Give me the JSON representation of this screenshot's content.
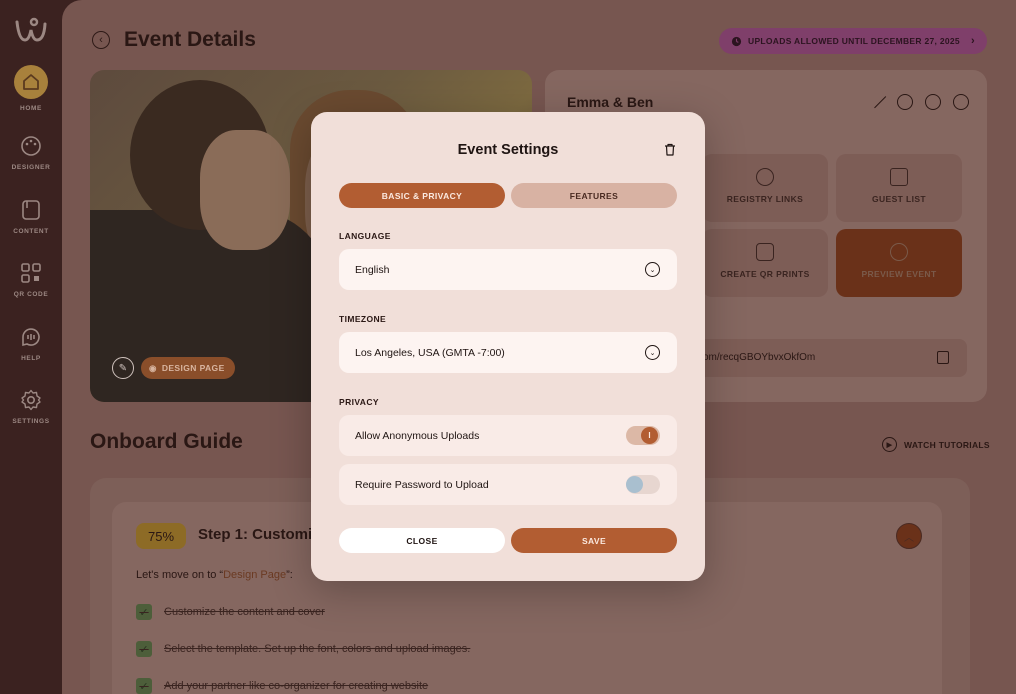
{
  "sidebar": {
    "items": [
      {
        "label": "HOME",
        "icon": "home-icon"
      },
      {
        "label": "DESIGNER",
        "icon": "palette-icon"
      },
      {
        "label": "CONTENT",
        "icon": "content-icon"
      },
      {
        "label": "QR CODE",
        "icon": "qr-code-icon"
      },
      {
        "label": "HELP",
        "icon": "help-icon"
      },
      {
        "label": "SETTINGS",
        "icon": "gear-icon"
      }
    ]
  },
  "header": {
    "title": "Event Details",
    "uploads_pill": "UPLOADS ALLOWED UNTIL DECEMBER 27, 2025"
  },
  "photo": {
    "design_label": "DESIGN PAGE"
  },
  "event_card": {
    "couple": "Emma & Ben",
    "tiles": [
      {
        "label": "REGISTRY LINKS"
      },
      {
        "label": "GUEST LIST"
      },
      {
        "label": "CREATE QR PRINTS"
      },
      {
        "label": "PREVIEW EVENT"
      }
    ],
    "url": "om/recqGBOYbvxOkfOm"
  },
  "onboard": {
    "title": "Onboard Guide",
    "watch_label": "WATCH TUTORIALS",
    "percent": "75%",
    "step_title": "Step 1: Customiz",
    "move_on_prefix": "Let's move on to “",
    "move_on_link": "Design Page",
    "move_on_suffix": "”:",
    "checklist": [
      "Customize the content and cover",
      "Select the template. Set up the font, colors and upload images.",
      "Add your partner like co-organizer for creating website"
    ]
  },
  "modal": {
    "title": "Event Settings",
    "tabs": [
      {
        "label": "BASIC & PRIVACY",
        "active": true
      },
      {
        "label": "FEATURES",
        "active": false
      }
    ],
    "language_label": "LANGUAGE",
    "language_value": "English",
    "timezone_label": "TIMEZONE",
    "timezone_value": "Los Angeles, USA (GMTA -7:00)",
    "privacy_label": "PRIVACY",
    "toggles": [
      {
        "label": "Allow Anonymous Uploads",
        "on": true,
        "knob_text": "I"
      },
      {
        "label": "Require Password to Upload",
        "on": false
      }
    ],
    "close_label": "CLOSE",
    "save_label": "SAVE"
  },
  "colors": {
    "accent": "#b25d32",
    "sidebar_bg": "#3b2220",
    "modal_bg": "#f1dfd9"
  }
}
